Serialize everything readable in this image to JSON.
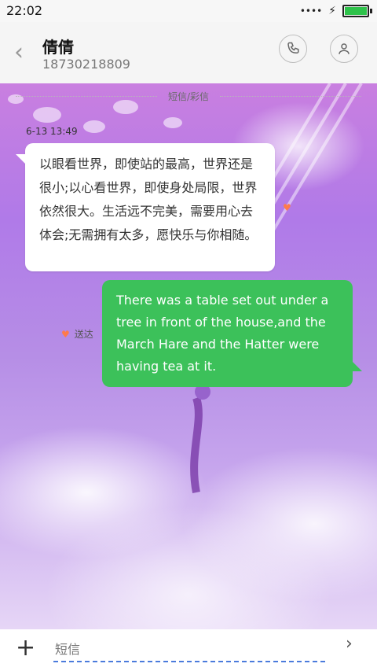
{
  "status": {
    "time": "22:02"
  },
  "header": {
    "contact_name": "倩倩",
    "phone": "18730218809"
  },
  "chat": {
    "section_label": "短信/彩信",
    "timestamp": "6-13 13:49",
    "incoming_text": "以眼看世界，即使站的最高，世界还是很小;以心看世界，即使身处局限，世界依然很大。生活远不完美，需要用心去体会;无需拥有太多，愿快乐与你相随。",
    "outgoing_text": "There was a table set out under a tree in front of the house,and the March Hare and the Hatter were having tea at it.",
    "delivered_label": "送达"
  },
  "composer": {
    "placeholder": "短信"
  },
  "icons": {
    "back": "chevron-left-icon",
    "call": "phone-icon",
    "profile": "person-icon",
    "add": "plus-icon",
    "send": "chevron-right-icon",
    "heart": "heart-icon",
    "battery": "battery-icon"
  },
  "colors": {
    "bubble_out": "#3cc15a",
    "bubble_in": "#ffffff",
    "accent": "#4b7bdc"
  }
}
